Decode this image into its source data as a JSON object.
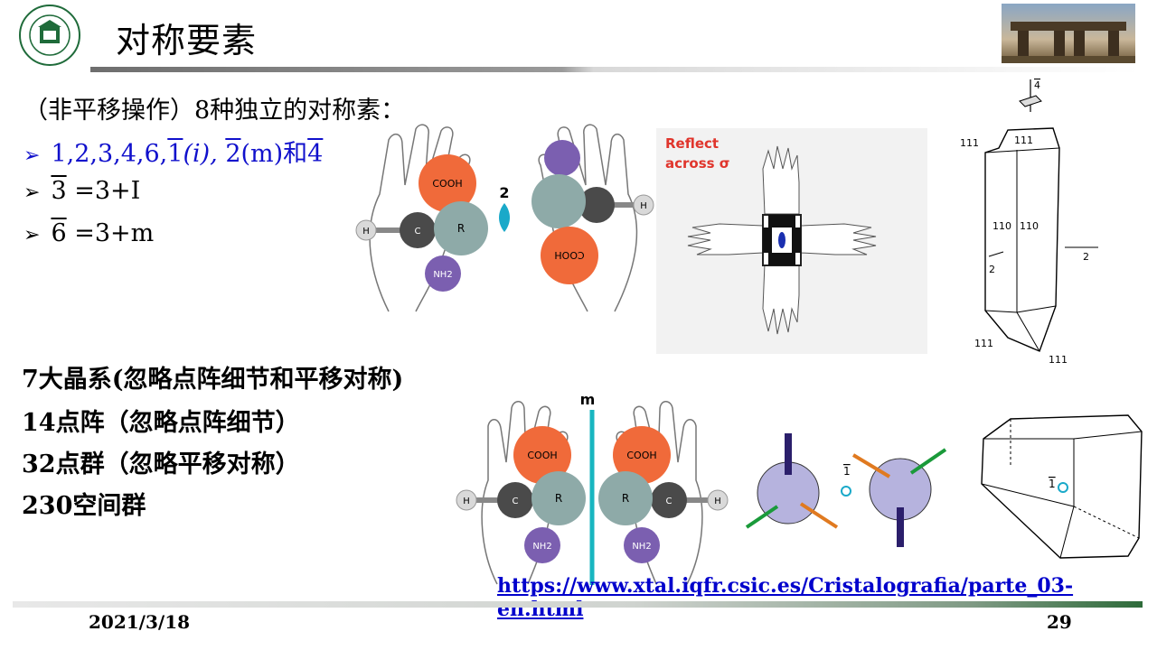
{
  "header": {
    "title": "对称要素"
  },
  "intro": "（非平移操作）8种独立的对称素：",
  "bullets": [
    {
      "prefix": "1,2,3,4,6,",
      "a": "1",
      "a_paren": "(i), ",
      "b": "2",
      "b_paren": "(m)和",
      "c": "4"
    },
    {
      "sym": "3",
      "text": " =3+I"
    },
    {
      "sym": "6",
      "text": " =3+m"
    }
  ],
  "summary": [
    "7大晶系(忽略点阵细节和平移对称)",
    "14点阵（忽略点阵细节）",
    "32点群（忽略平移对称）",
    "230空间群"
  ],
  "figures": {
    "hand_labels": {
      "cooh": "COOH",
      "r": "R",
      "c": "C",
      "h": "H",
      "nh2": "NH2"
    },
    "twofold_label": "2",
    "reflect_text": [
      "Reflect",
      "across σ"
    ],
    "crystal_labels": [
      "4",
      "111",
      "111",
      "110",
      "110",
      "2",
      "2",
      "111",
      "111"
    ],
    "mirror_label": "m",
    "inversion_label": "1",
    "crystal2_label": "1"
  },
  "link": "https://www.xtal.iqfr.csic.es/Cristalografia/parte_03-en.html",
  "footer": {
    "date": "2021/3/18",
    "page": "29"
  }
}
